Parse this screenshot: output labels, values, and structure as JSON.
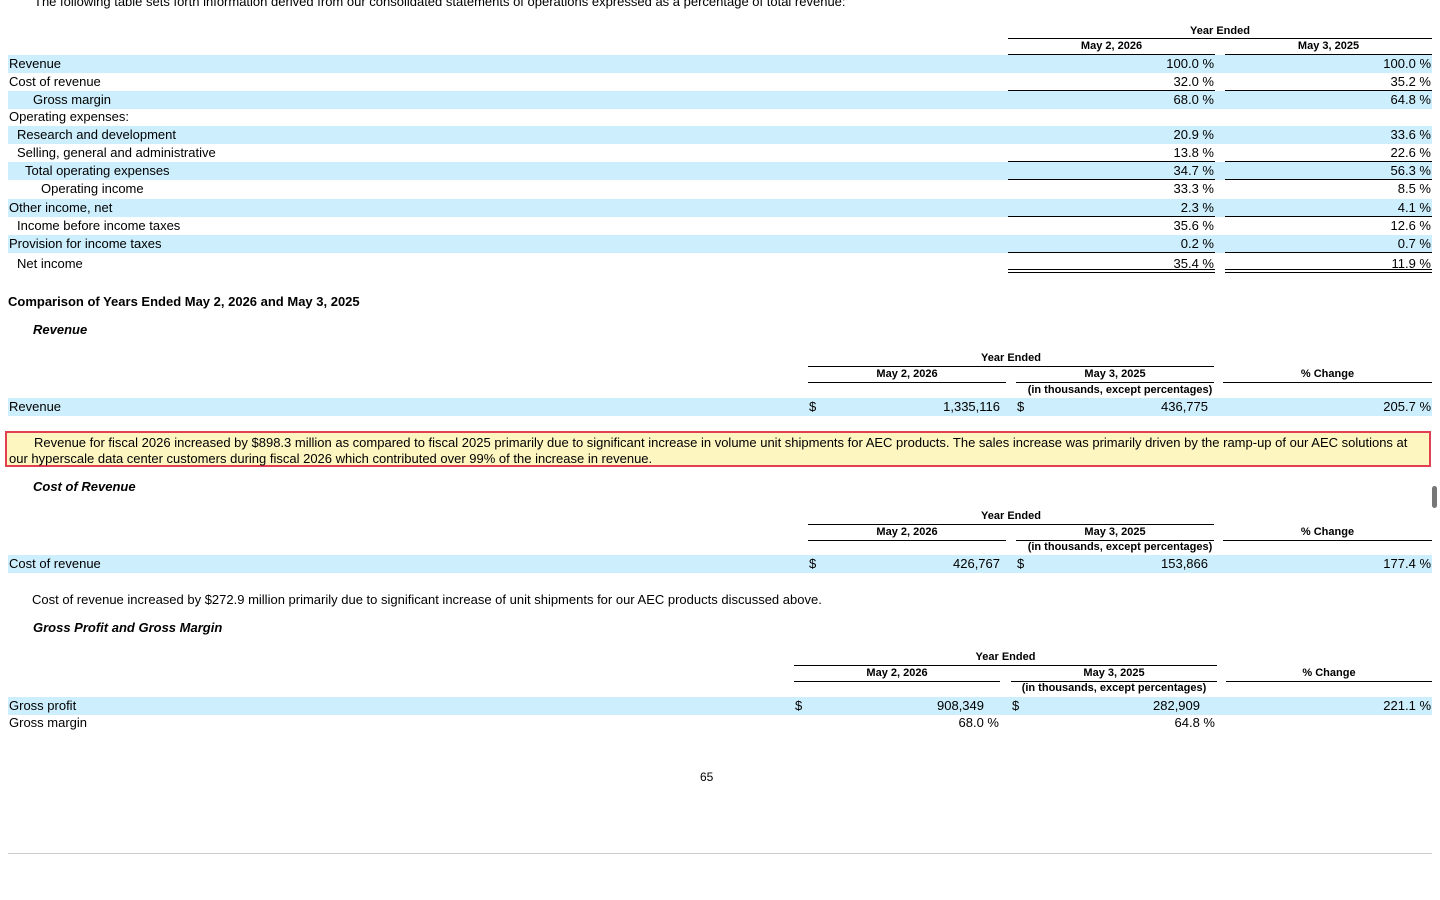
{
  "intro_text": "The following table sets forth information derived from our consolidated statements of operations expressed as a percentage of total revenue:",
  "pct_table": {
    "header_group": "Year Ended",
    "col1": "May 2, 2026",
    "col2": "May 3, 2025",
    "rows": [
      {
        "label": "Revenue",
        "v1": "100.0 %",
        "v2": "100.0 %"
      },
      {
        "label": "Cost of revenue",
        "v1": "32.0 %",
        "v2": "35.2 %"
      },
      {
        "label": "Gross margin",
        "v1": "68.0 %",
        "v2": "64.8 %"
      },
      {
        "label": "Operating expenses:",
        "v1": "",
        "v2": ""
      },
      {
        "label": "Research and development",
        "v1": "20.9 %",
        "v2": "33.6 %"
      },
      {
        "label": "Selling, general and administrative",
        "v1": "13.8 %",
        "v2": "22.6 %"
      },
      {
        "label": "Total operating expenses",
        "v1": "34.7 %",
        "v2": "56.3 %"
      },
      {
        "label": "Operating income",
        "v1": "33.3 %",
        "v2": "8.5 %"
      },
      {
        "label": "Other income, net",
        "v1": "2.3 %",
        "v2": "4.1 %"
      },
      {
        "label": "Income before income taxes",
        "v1": "35.6 %",
        "v2": "12.6 %"
      },
      {
        "label": "Provision for income taxes",
        "v1": "0.2 %",
        "v2": "0.7 %"
      },
      {
        "label": "Net income",
        "v1": "35.4 %",
        "v2": "11.9 %"
      }
    ]
  },
  "comparison_title": "Comparison of Years Ended May 2, 2026 and May 3, 2025",
  "revenue_section": {
    "title": "Revenue",
    "header_group": "Year Ended",
    "col1": "May 2, 2026",
    "col2": "May 3, 2025",
    "units": "(in thousands, except percentages)",
    "col3": "% Change",
    "row": {
      "label": "Revenue",
      "cur1": "$",
      "v1": "1,335,116",
      "cur2": "$",
      "v2": "436,775",
      "change": "205.7 %"
    },
    "note": "Revenue for fiscal 2026 increased by $898.3 million as compared to fiscal 2025 primarily due to significant increase in volume unit shipments for AEC products. The sales increase was primarily driven by the ramp-up of our AEC solutions at our hyperscale data center customers during fiscal 2026 which contributed over 99% of the increase in revenue."
  },
  "cost_section": {
    "title": "Cost of Revenue",
    "header_group": "Year Ended",
    "col1": "May 2, 2026",
    "col2": "May 3, 2025",
    "units": "(in thousands, except percentages)",
    "col3": "% Change",
    "row": {
      "label": "Cost of revenue",
      "cur1": "$",
      "v1": "426,767",
      "cur2": "$",
      "v2": "153,866",
      "change": "177.4 %"
    },
    "note": "Cost of revenue increased by $272.9 million primarily due to significant increase of unit shipments for our AEC products discussed above."
  },
  "gross_section": {
    "title": "Gross Profit and Gross Margin",
    "header_group": "Year Ended",
    "col1": "May 2, 2026",
    "col2": "May 3, 2025",
    "units": "(in thousands, except percentages)",
    "col3": "% Change",
    "row1": {
      "label": "Gross profit",
      "cur1": "$",
      "v1": "908,349",
      "cur2": "$",
      "v2": "282,909",
      "change": "221.1 %"
    },
    "row2": {
      "label": "Gross margin",
      "v1": "68.0 %",
      "v2": "64.8 %"
    }
  },
  "page_number": "65"
}
